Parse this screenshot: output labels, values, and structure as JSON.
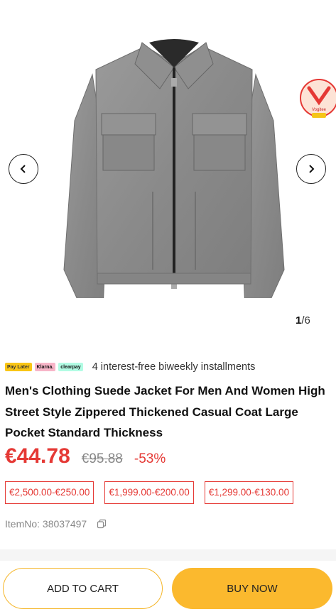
{
  "gallery": {
    "image_alt": "Grey suede zip jacket",
    "counter_current": "1",
    "counter_total": "/6",
    "badge_text": "Vogitee"
  },
  "installments": {
    "logos": [
      "Pay Later",
      "Klarna.",
      "clearpay"
    ],
    "text": "4 interest-free biweekly installments"
  },
  "product": {
    "title": "Men's Clothing Suede Jacket For Men And Women High Street Style Zippered Thickened Casual Coat Large Pocket Standard Thickness",
    "price": "€44.78",
    "original_price": "€95.88",
    "discount": "-53%",
    "coupons": [
      "€2,500.00-€250.00",
      "€1,999.00-€200.00",
      "€1,299.00-€130.00"
    ],
    "item_no": "ItemNo: 38037497"
  },
  "actions": {
    "add_to_cart": "ADD TO CART",
    "buy_now": "BUY NOW"
  },
  "colors": {
    "accent_red": "#e53935",
    "buy_yellow": "#fbb92e",
    "cart_border": "#f5b62a"
  },
  "icons": [
    "chevron-left-icon",
    "chevron-right-icon",
    "copy-icon"
  ]
}
